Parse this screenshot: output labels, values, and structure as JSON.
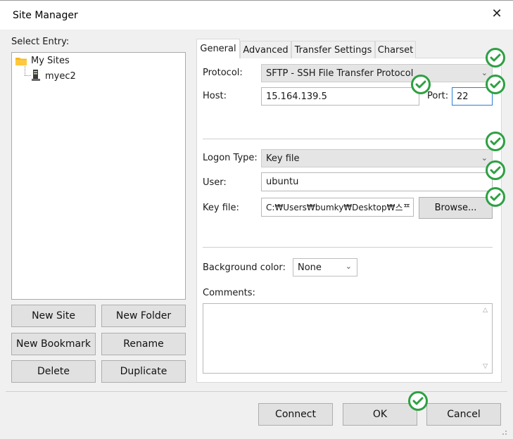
{
  "window": {
    "title": "Site Manager",
    "close_glyph": "✕"
  },
  "tree": {
    "heading": "Select Entry:",
    "root": {
      "label": "My Sites",
      "icon": "folder-icon"
    },
    "child": {
      "label": "myec2",
      "icon": "server-icon"
    }
  },
  "left_buttons": {
    "new_site": "New Site",
    "new_folder": "New Folder",
    "new_bookmark": "New Bookmark",
    "rename": "Rename",
    "delete": "Delete",
    "duplicate": "Duplicate"
  },
  "tabs": [
    "General",
    "Advanced",
    "Transfer Settings",
    "Charset"
  ],
  "general": {
    "protocol_label": "Protocol:",
    "protocol_value": "SFTP - SSH File Transfer Protocol",
    "host_label": "Host:",
    "host_value": "15.164.139.5",
    "port_label": "Port:",
    "port_value": "22",
    "logon_type_label": "Logon Type:",
    "logon_type_value": "Key file",
    "user_label": "User:",
    "user_value": "ubuntu",
    "keyfile_label": "Key file:",
    "keyfile_value": "C:₩Users₩bumky₩Desktop₩스ᄑ",
    "browse_label": "Browse...",
    "bg_color_label": "Background color:",
    "bg_color_value": "None",
    "comments_label": "Comments:"
  },
  "footer": {
    "connect": "Connect",
    "ok": "OK",
    "cancel": "Cancel"
  },
  "colors": {
    "check_green": "#2ea043",
    "focus_blue": "#2a7fd4"
  }
}
